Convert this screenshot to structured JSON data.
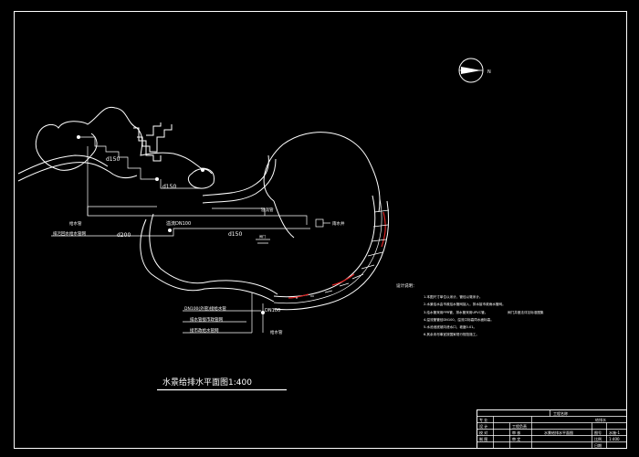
{
  "drawing": {
    "title": "水景给排水平面图1:400",
    "north_mark": "N"
  },
  "pipe_labels": {
    "d150_upper": "d150",
    "d150_mid": "d150",
    "d150_right": "d150",
    "d200": "d200",
    "dn100_upper": "溢流DN100",
    "dn100_lower": "DN100",
    "inlet_left": "给水管",
    "inlet_left_sub": "排污回水给水管网",
    "overflow_right": "溢流管",
    "drain_box": "雨水井",
    "small_mark": "阀门",
    "valve_callout_1": "DN100(外管)接给水管",
    "valve_callout_2": "排水管接市政管网",
    "valve_callout_3": "接市政给水管网",
    "valve_callout_right": "给水管"
  },
  "notes": {
    "heading": "设计说明：",
    "items": [
      "1.本图尺寸单位以米计，管径以毫米计。",
      "2.水景给水由市政给水管网接入，排水接市政雨水管网。",
      "3.给水管采用PPR管，排水管采用UPVC管。",
      "4.溢流管管径DN100，溢流口标高同水面标高。",
      "5.水池池底坡向泄水口，坡度0.01。",
      "6.其余未尽事宜按国家现行规范施工。"
    ],
    "side_note": "阀门井做法详见标准图集"
  },
  "title_block": {
    "r1_a": "工程名称",
    "r2_a": "专 业",
    "r2_b": "给排水",
    "r3_a": "设 计",
    "r3_b": "工程负责",
    "r3_c": "水景给排水平面图",
    "r4_a": "校 对",
    "r4_b": "审 核",
    "r4_c": "图号",
    "r4_d": "水施-1",
    "r5_a": "制 图",
    "r5_b": "审 定",
    "r5_c": "比例",
    "r5_d": "1:400",
    "r6_c": "日期"
  }
}
